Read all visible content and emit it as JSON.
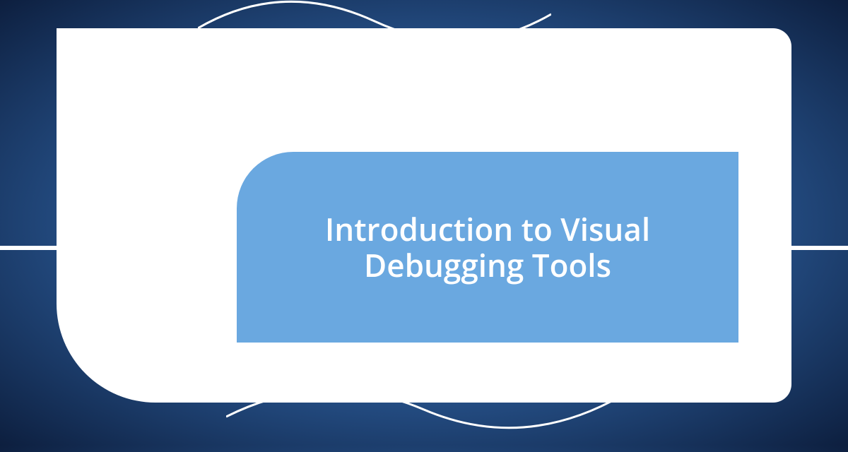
{
  "title": {
    "line1": "Introduction to Visual",
    "line2": "Debugging Tools"
  },
  "colors": {
    "background_dark": "#0d1f3f",
    "background_mid": "#2d5f9e",
    "background_light": "#6ba8e0",
    "frame": "#ffffff",
    "inner_panel": "#6aa8e0",
    "title_text": "#ffffff"
  }
}
